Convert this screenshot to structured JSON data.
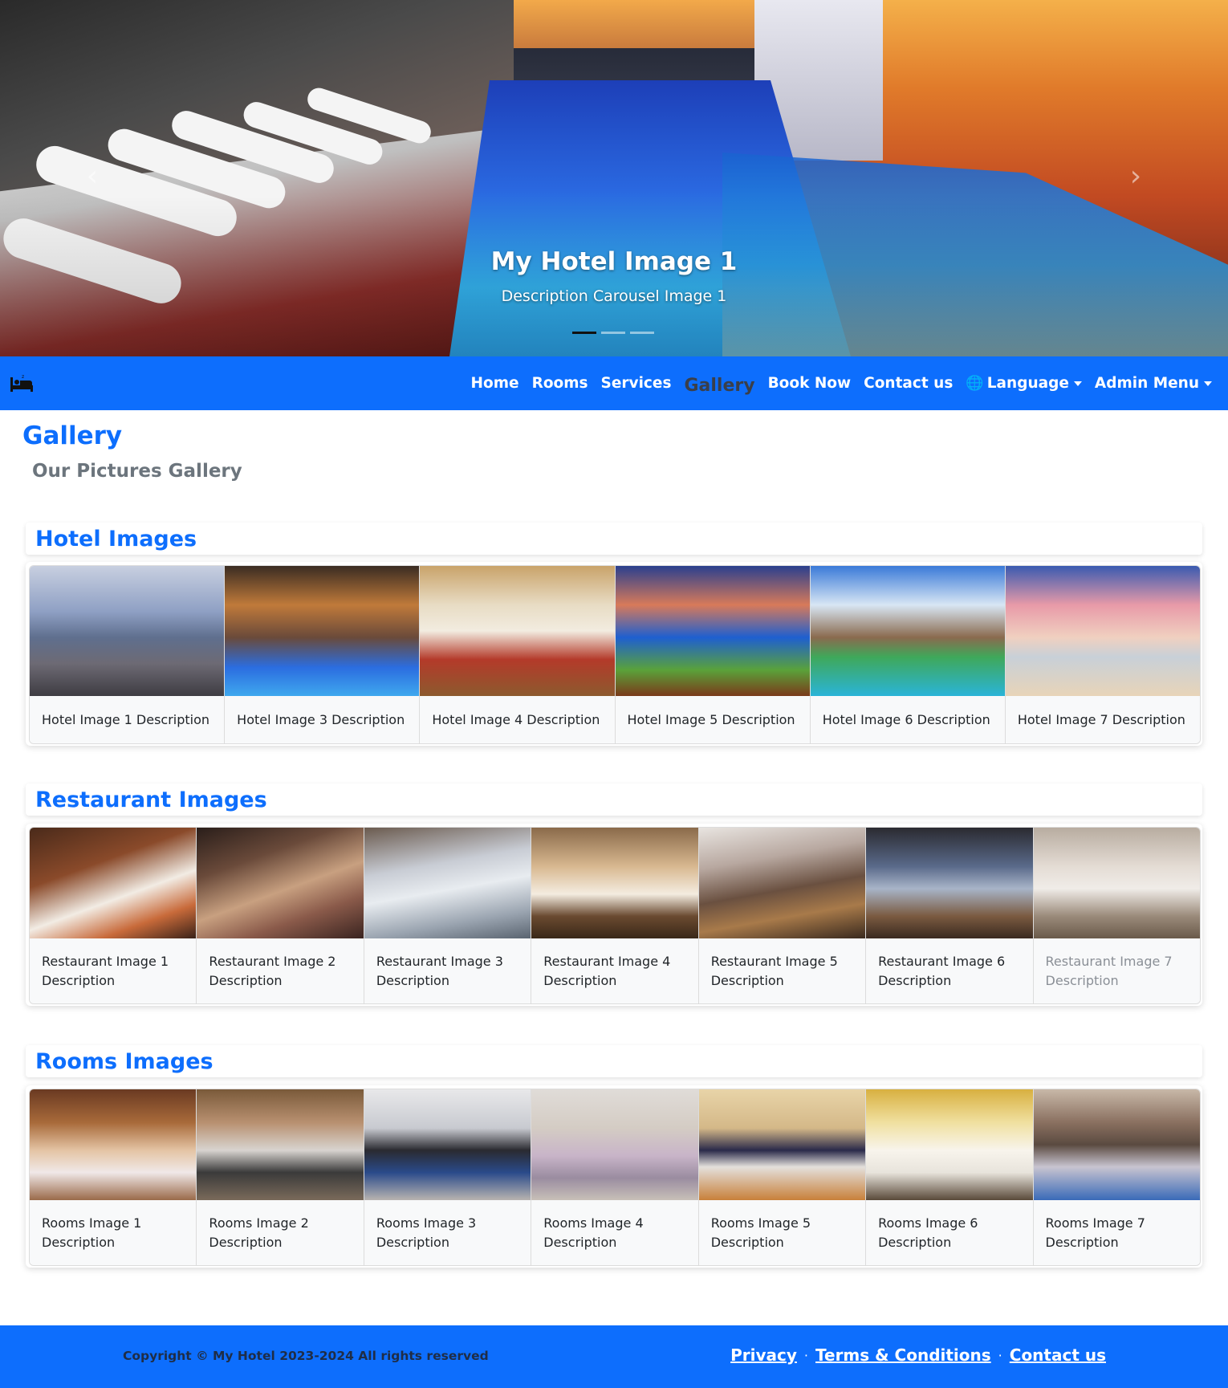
{
  "carousel": {
    "title": "My Hotel Image 1",
    "description": "Description Carousel Image 1",
    "prev_icon": "chevron-left-icon",
    "next_icon": "chevron-right-icon",
    "slide_count": 3,
    "active_slide": 1
  },
  "navbar": {
    "brand_icon": "hotel-bed-icon",
    "links": {
      "home": "Home",
      "rooms": "Rooms",
      "services": "Services",
      "gallery": "Gallery",
      "book_now": "Book Now",
      "contact_us": "Contact us",
      "language": "Language",
      "admin_menu": "Admin Menu"
    },
    "active": "Gallery"
  },
  "page": {
    "title": "Gallery",
    "subtitle": "Our Pictures Gallery"
  },
  "sections": {
    "hotel": {
      "title": "Hotel Images",
      "items": [
        {
          "caption": "Hotel Image 1 Description"
        },
        {
          "caption": "Hotel Image 3 Description"
        },
        {
          "caption": "Hotel Image 4 Description"
        },
        {
          "caption": "Hotel Image 5 Description"
        },
        {
          "caption": "Hotel Image 6 Description"
        },
        {
          "caption": "Hotel Image 7 Description"
        }
      ]
    },
    "restaurant": {
      "title": "Restaurant Images",
      "items": [
        {
          "caption": "Restaurant Image 1 Description"
        },
        {
          "caption": "Restaurant Image 2 Description"
        },
        {
          "caption": "Restaurant Image 3 Description"
        },
        {
          "caption": "Restaurant Image 4 Description"
        },
        {
          "caption": "Restaurant Image 5 Description"
        },
        {
          "caption": "Restaurant Image 6 Description"
        },
        {
          "caption": "Restaurant Image 7 Description"
        }
      ]
    },
    "rooms": {
      "title": "Rooms Images",
      "items": [
        {
          "caption": "Rooms Image 1 Description"
        },
        {
          "caption": "Rooms Image 2 Description"
        },
        {
          "caption": "Rooms Image 3 Description"
        },
        {
          "caption": "Rooms Image 4 Description"
        },
        {
          "caption": "Rooms Image 5 Description"
        },
        {
          "caption": "Rooms Image 6 Description"
        },
        {
          "caption": "Rooms Image 7 Description"
        }
      ]
    }
  },
  "footer": {
    "copyright": "Copyright © My Hotel 2023-2024 All rights reserved",
    "links": {
      "privacy": "Privacy",
      "terms": "Terms & Conditions",
      "contact": "Contact us"
    },
    "separator": "·"
  },
  "colors": {
    "primary": "#0d6efd",
    "muted_heading": "#6c757d",
    "caption_bg": "#f8f9fa"
  }
}
